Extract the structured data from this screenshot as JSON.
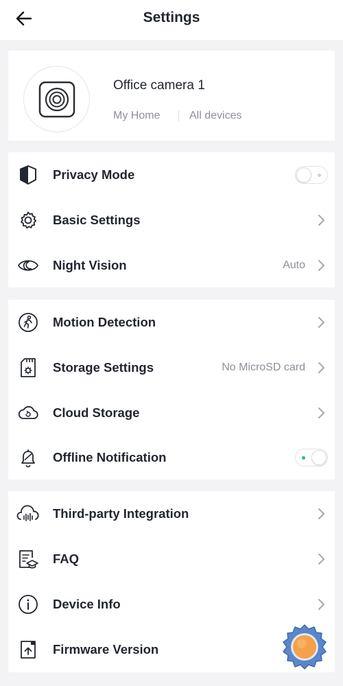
{
  "header": {
    "title": "Settings"
  },
  "device": {
    "name": "Office camera 1",
    "home": "My Home",
    "all_devices": "All devices"
  },
  "groups": [
    {
      "items": [
        {
          "label": "Privacy Mode",
          "icon": "shield-half-icon",
          "control": "toggle",
          "toggle_on": false
        },
        {
          "label": "Basic Settings",
          "icon": "gear-icon",
          "control": "chevron"
        },
        {
          "label": "Night Vision",
          "icon": "eye-moon-icon",
          "value": "Auto",
          "control": "chevron"
        }
      ]
    },
    {
      "items": [
        {
          "label": "Motion Detection",
          "icon": "running-person-icon",
          "control": "chevron"
        },
        {
          "label": "Storage Settings",
          "icon": "sd-card-icon",
          "value": "No MicroSD card",
          "control": "chevron"
        },
        {
          "label": "Cloud Storage",
          "icon": "cloud-icon",
          "control": "chevron"
        },
        {
          "label": "Offline Notification",
          "icon": "bell-off-icon",
          "control": "toggle",
          "toggle_on": true
        }
      ]
    },
    {
      "items": [
        {
          "label": "Third-party Integration",
          "icon": "cloud-wave-icon",
          "control": "chevron"
        },
        {
          "label": "FAQ",
          "icon": "faq-document-icon",
          "control": "chevron"
        },
        {
          "label": "Device Info",
          "icon": "info-icon",
          "control": "chevron"
        },
        {
          "label": "Firmware Version",
          "icon": "firmware-upload-icon",
          "control": "none"
        }
      ]
    }
  ],
  "colors": {
    "background": "#f3f3f5",
    "card": "#ffffff",
    "text": "#22262f",
    "muted": "#8d9099",
    "toggle_on_dot": "#2bc06a",
    "fab_orange": "#f5a04a",
    "fab_blue": "#5b86c8"
  }
}
